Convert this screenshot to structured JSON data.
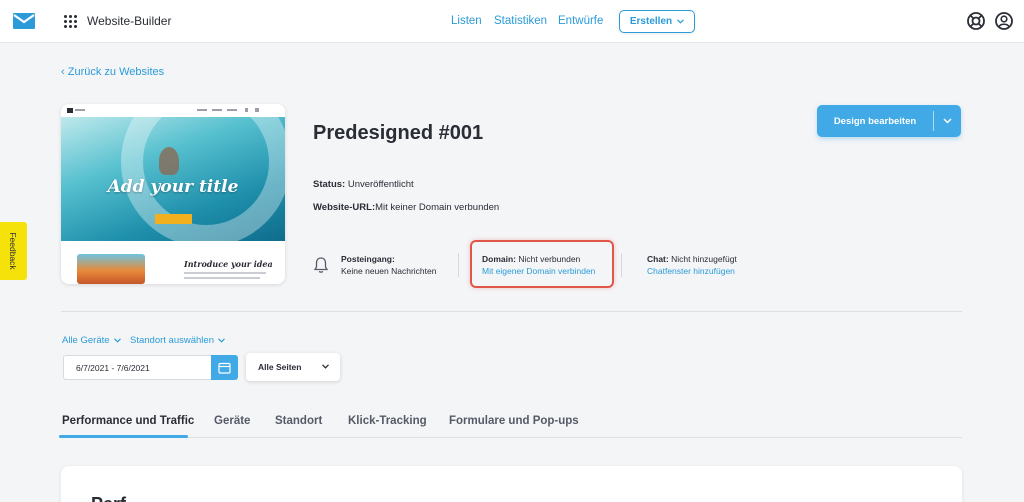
{
  "topbar": {
    "app_title": "Website-Builder",
    "nav": [
      "Listen",
      "Statistiken",
      "Entwürfe"
    ],
    "create_label": "Erstellen"
  },
  "back_link": "Zurück zu Websites",
  "preview": {
    "hero_title": "Add your title",
    "section_title": "Introduce your idea"
  },
  "site": {
    "title": "Predesigned #001",
    "status_label": "Status:",
    "status_value": "Unveröffentlicht",
    "url_label": "Website-URL:",
    "url_value": "Mit keiner Domain verbunden"
  },
  "design_button": "Design bearbeiten",
  "inbox": {
    "label": "Posteingang:",
    "value": "Keine neuen Nachrichten"
  },
  "domain": {
    "label": "Domain:",
    "value": "Nicht verbunden",
    "link": "Mit eigener Domain verbinden"
  },
  "chat": {
    "label": "Chat:",
    "value": "Nicht hinzugefügt",
    "link": "Chatfenster hinzufügen"
  },
  "filters": {
    "devices": "Alle Geräte",
    "location": "Standort auswählen"
  },
  "date_range": "6/7/2021 - 7/6/2021",
  "page_select": "Alle Seiten",
  "tabs": [
    "Performance und Traffic",
    "Geräte",
    "Standort",
    "Klick-Tracking",
    "Formulare und Pop-ups"
  ],
  "card_heading": "Perf",
  "feedback": "Feedback",
  "colors": {
    "accent": "#40a9e6",
    "link": "#2a9bd8",
    "highlight": "#e0574a",
    "feedback": "#f4e20a"
  }
}
